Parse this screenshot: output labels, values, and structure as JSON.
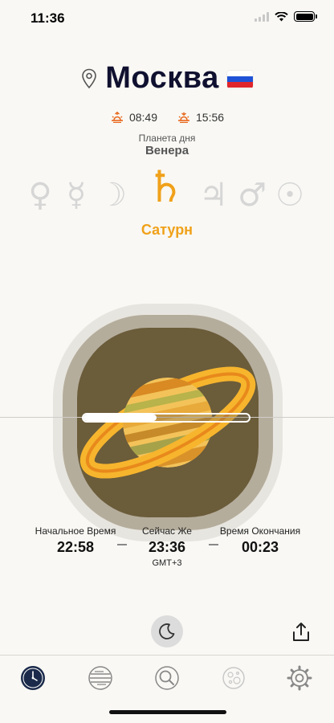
{
  "status": {
    "time": "11:36"
  },
  "location": {
    "city": "Москва",
    "flag_colors": [
      "#ffffff",
      "#1f52d6",
      "#e0242b"
    ]
  },
  "sun": {
    "sunrise": "08:49",
    "sunset": "15:56"
  },
  "planet_of_day": {
    "label": "Планета дня",
    "value": "Венера"
  },
  "planets": {
    "symbols": [
      "♀",
      "☿",
      "☽",
      "♄",
      "♃",
      "♂",
      "☉"
    ],
    "active_index": 3,
    "active_name": "Сатурн"
  },
  "hour": {
    "progress": 0.44,
    "start_label": "Начальное Время",
    "start_time": "22:58",
    "now_label": "Сейчас Же",
    "now_time": "23:36",
    "timezone": "GMT+3",
    "end_label": "Время Окончания",
    "end_time": "00:23"
  },
  "icons": {
    "location": "pin-icon",
    "sunrise": "sunrise-icon",
    "sunset": "sunset-icon",
    "night_mode": "moon-icon",
    "share": "share-icon"
  },
  "tabs": [
    {
      "name": "clock-tab",
      "icon": "clock-icon",
      "active": true
    },
    {
      "name": "planet-tab",
      "icon": "planet-lines-icon",
      "active": false
    },
    {
      "name": "search-tab",
      "icon": "magnifier-icon",
      "active": false
    },
    {
      "name": "moon-tab",
      "icon": "moon-craters-icon",
      "active": false
    },
    {
      "name": "settings-tab",
      "icon": "gear-icon",
      "active": false
    }
  ],
  "colors": {
    "accent": "#f0a11a",
    "sun_icon": "#e8661a",
    "active_tab": "#1b2a4a"
  }
}
